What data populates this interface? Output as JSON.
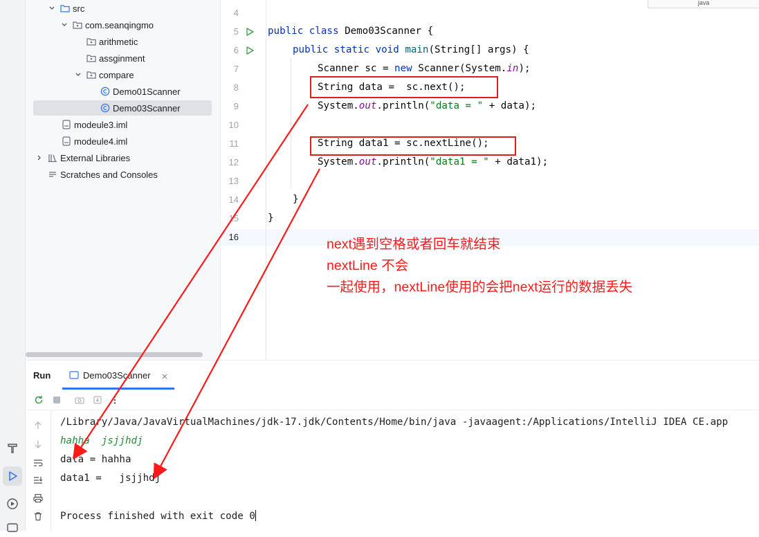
{
  "project_tree": {
    "items": [
      {
        "label": "src",
        "depth": 0
      },
      {
        "label": "com.seanqingmo",
        "depth": 1
      },
      {
        "label": "arithmetic",
        "depth": 2
      },
      {
        "label": "assginment",
        "depth": 2
      },
      {
        "label": "compare",
        "depth": 2
      },
      {
        "label": "Demo01Scanner",
        "depth": 3
      },
      {
        "label": "Demo03Scanner",
        "depth": 3,
        "selected": true
      },
      {
        "label": "modeule3.iml",
        "depth": 1
      },
      {
        "label": "modeule4.iml",
        "depth": 1
      },
      {
        "label": "External Libraries",
        "depth": 0
      },
      {
        "label": "Scratches and Consoles",
        "depth": 0
      }
    ]
  },
  "editor": {
    "corner_tag": "java",
    "line_numbers": [
      "4",
      "5",
      "6",
      "7",
      "8",
      "9",
      "10",
      "11",
      "12",
      "13",
      "14",
      "15",
      "16"
    ],
    "current_line": "16",
    "code": {
      "l5": {
        "kw1": "public",
        "kw2": "class",
        "name": "Demo03Scanner",
        "rest": " {"
      },
      "l6": {
        "kw1": "public",
        "kw2": "static",
        "kw3": "void",
        "fn": "main",
        "rest": "(String[] args) {"
      },
      "l7": {
        "a": "Scanner sc = ",
        "kw": "new",
        "b": " Scanner(System.",
        "it": "in",
        "c": ");"
      },
      "l8": {
        "a": "String data =  sc.next();"
      },
      "l9": {
        "a": "System.",
        "it": "out",
        "b": ".println(",
        "str": "\"data = \"",
        "c": " + data);"
      },
      "l11": {
        "a": "String data1 = sc.nextLine();"
      },
      "l12": {
        "a": "System.",
        "it": "out",
        "b": ".println(",
        "str": "\"data1 = \"",
        "c": " + data1);"
      },
      "l14": {
        "a": "}"
      },
      "l15": {
        "a": "}"
      }
    },
    "annotation": [
      "next遇到空格或者回车就结束",
      "nextLine 不会",
      "一起使用，nextLine使用的会把next运行的数据丢失"
    ]
  },
  "run_panel": {
    "title": "Run",
    "tab_label": "Demo03Scanner",
    "console": [
      {
        "text": "/Library/Java/JavaVirtualMachines/jdk-17.jdk/Contents/Home/bin/java -javaagent:/Applications/IntelliJ IDEA CE.app",
        "kind": "cmd"
      },
      {
        "text": "hahha  jsjjhdj",
        "kind": "input"
      },
      {
        "text": "data = hahha",
        "kind": "out"
      },
      {
        "text": "data1 =   jsjjhdj",
        "kind": "out"
      },
      {
        "text": "",
        "kind": "out"
      },
      {
        "text": "Process finished with exit code 0",
        "kind": "out"
      }
    ]
  },
  "colors": {
    "annotation_red": "#ff1a1a",
    "box_red": "#e01b1b",
    "keyword": "#0033b3",
    "string": "#067d17",
    "field": "#871094",
    "accent_blue": "#3574f0"
  }
}
